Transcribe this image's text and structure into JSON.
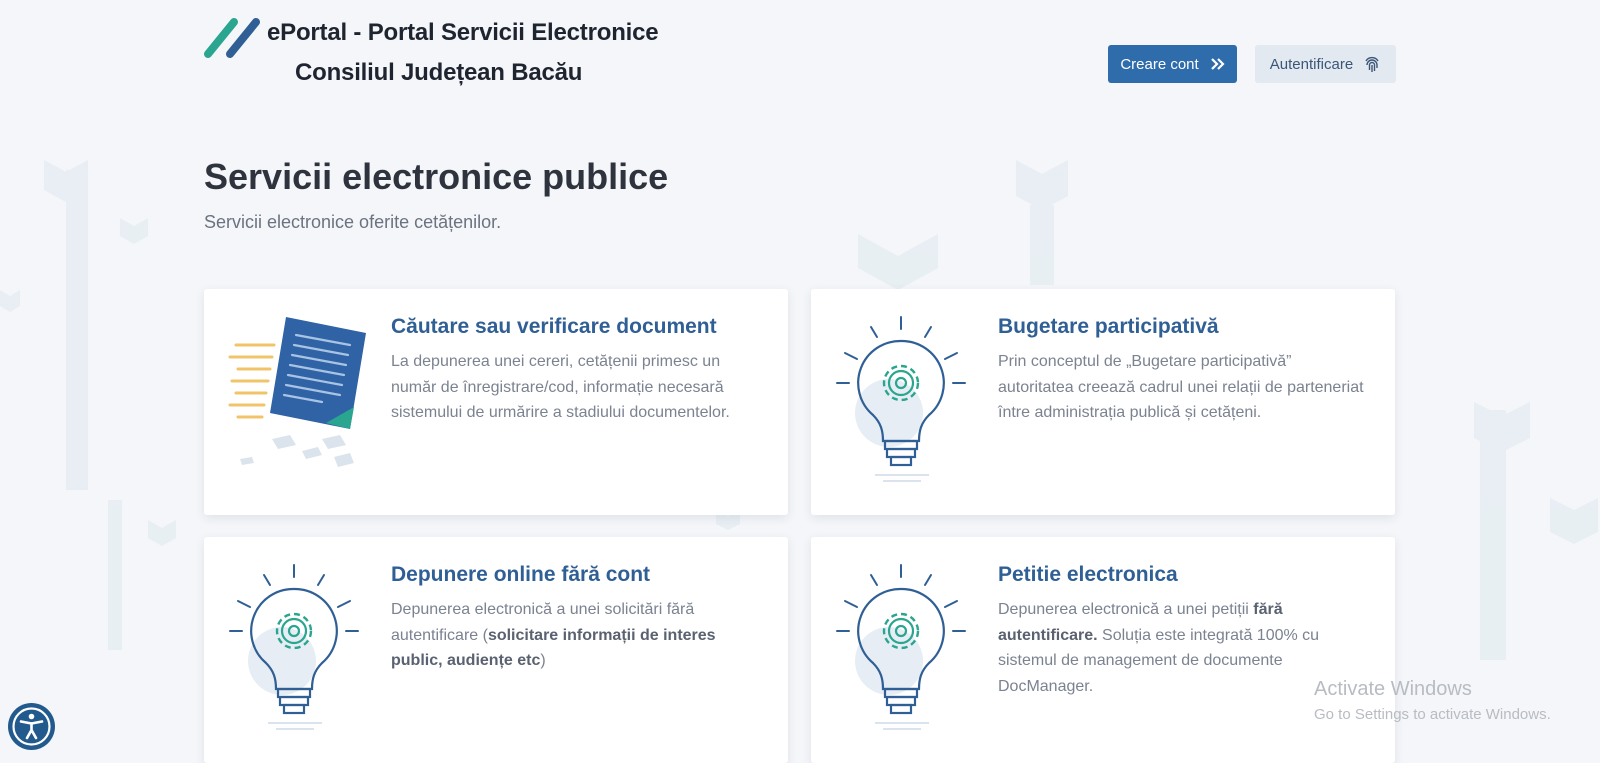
{
  "header": {
    "brand_line1": "ePortal - Portal Servicii Electronice",
    "brand_line2": "Consiliul Județean Bacău",
    "create_account_label": "Creare cont",
    "login_label": "Autentificare"
  },
  "main": {
    "title": "Servicii electronice publice",
    "subtitle": "Servicii electronice oferite cetățenilor."
  },
  "services": [
    {
      "title": "Căutare sau verificare document",
      "description": "La depunerea unei cereri, cetățenii primesc un număr de înregistrare/cod, informație necesară sistemului de urmărire a stadiului documentelor.",
      "icon": "document-icon"
    },
    {
      "title": "Bugetare participativă",
      "description": "Prin conceptul de „Bugetare participativă” autoritatea creează cadrul unei relații de parteneriat între administrația publică și cetățeni.",
      "icon": "lightbulb-gear-icon"
    },
    {
      "title": "Depunere online fără cont",
      "desc_pre": "Depunerea electronică a unei solicitări fără autentificare (",
      "desc_bold": "solicitare informații de interes public, audiențe etc",
      "desc_post": ")",
      "icon": "lightbulb-gear-icon"
    },
    {
      "title": "Petitie electronica",
      "desc_pre": "Depunerea electronică a unei petiții ",
      "desc_bold": "fără autentificare.",
      "desc_post": " Soluția este integrată 100% cu sistemul de management de documente DocManager.",
      "icon": "lightbulb-gear-icon"
    }
  ],
  "watermark": {
    "line1": "Activate Windows",
    "line2": "Go to Settings to activate Windows."
  },
  "colors": {
    "primary": "#2f6cab",
    "title_blue": "#2f5f94",
    "teal_accent": "#2aa58f",
    "background": "#f4f6f9"
  }
}
